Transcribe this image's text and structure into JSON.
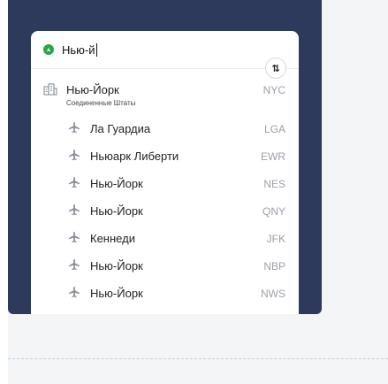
{
  "search": {
    "value": "Нью-й",
    "origin_icon": "origin-location-icon",
    "swap_icon": "swap-vertical-icon",
    "swap_label": "⇅"
  },
  "city": {
    "name": "Нью-Йорк",
    "country": "Соединенные Штаты",
    "code": "NYC",
    "icon": "city-buildings-icon"
  },
  "airports": [
    {
      "name": "Ла Гуардиа",
      "code": "LGA",
      "icon": "plane-icon"
    },
    {
      "name": "Ньюарк Либерти",
      "code": "EWR",
      "icon": "plane-icon"
    },
    {
      "name": "Нью-Йорк",
      "code": "NES",
      "icon": "plane-icon"
    },
    {
      "name": "Нью-Йорк",
      "code": "QNY",
      "icon": "plane-icon"
    },
    {
      "name": "Кеннеди",
      "code": "JFK",
      "icon": "plane-icon"
    },
    {
      "name": "Нью-Йорк",
      "code": "NBP",
      "icon": "plane-icon"
    },
    {
      "name": "Нью-Йорк",
      "code": "NWS",
      "icon": "plane-icon"
    }
  ],
  "colors": {
    "panel": "#2e3a5c",
    "origin_dot": "#2aa745",
    "code_text": "#9aa0a8"
  }
}
